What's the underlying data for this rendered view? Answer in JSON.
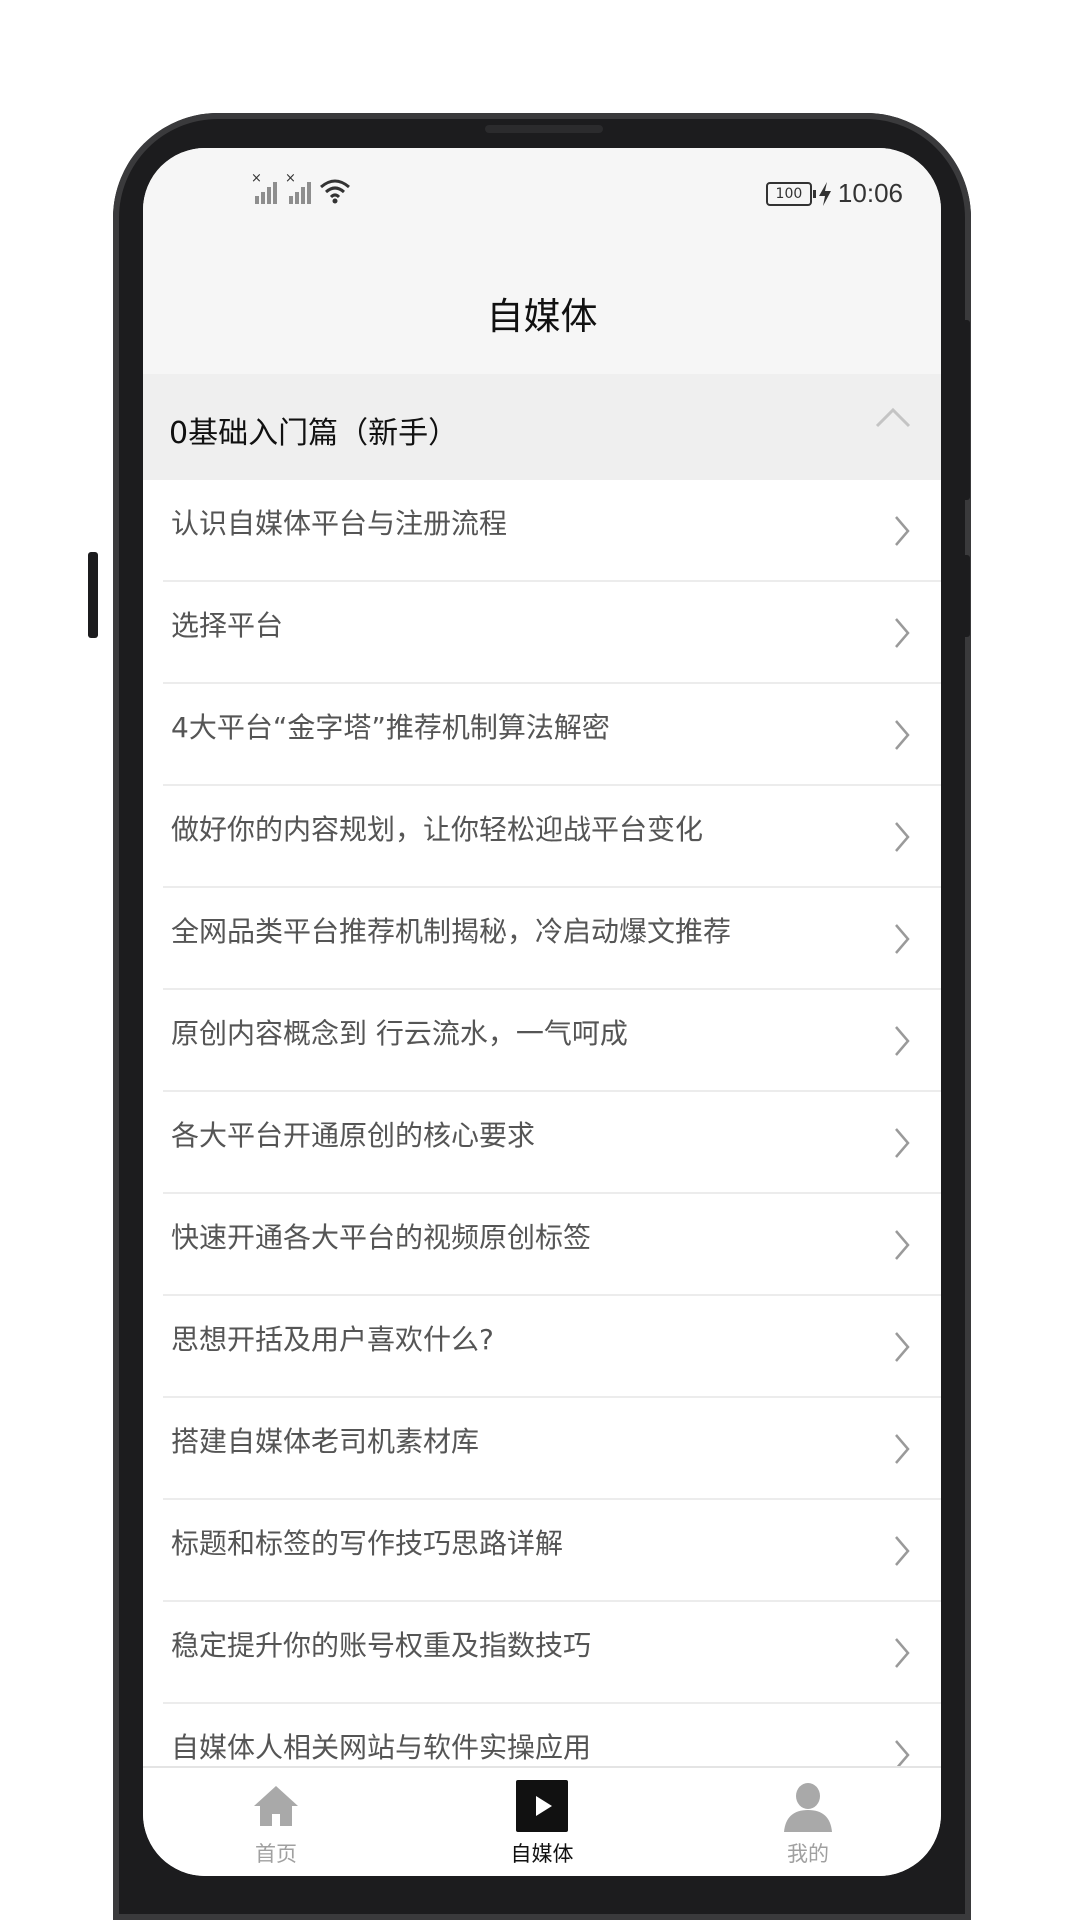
{
  "status_bar": {
    "time": "10:06",
    "battery": "100"
  },
  "header": {
    "title": "自媒体"
  },
  "section": {
    "title": "0基础入门篇（新手）",
    "items": [
      {
        "label": "认识自媒体平台与注册流程"
      },
      {
        "label": "选择平台"
      },
      {
        "label": "4大平台“金字塔”推荐机制算法解密"
      },
      {
        "label": "做好你的内容规划，让你轻松迎战平台变化"
      },
      {
        "label": "全网品类平台推荐机制揭秘，冷启动爆文推荐"
      },
      {
        "label": "原创内容概念到 行云流水，一气呵成"
      },
      {
        "label": "各大平台开通原创的核心要求"
      },
      {
        "label": "快速开通各大平台的视频原创标签"
      },
      {
        "label": "思想开括及用户喜欢什么?"
      },
      {
        "label": "搭建自媒体老司机素材库"
      },
      {
        "label": "标题和标签的写作技巧思路详解"
      },
      {
        "label": "稳定提升你的账号权重及指数技巧"
      },
      {
        "label": "自媒体人相关网站与软件实操应用"
      }
    ]
  },
  "tabbar": {
    "tabs": [
      {
        "label": "首页",
        "icon": "home-icon"
      },
      {
        "label": "自媒体",
        "icon": "play-icon"
      },
      {
        "label": "我的",
        "icon": "user-icon"
      }
    ],
    "active_index": 1
  },
  "colors": {
    "active": "#111111",
    "inactive": "#a0a0a0",
    "item_text": "#555555"
  }
}
